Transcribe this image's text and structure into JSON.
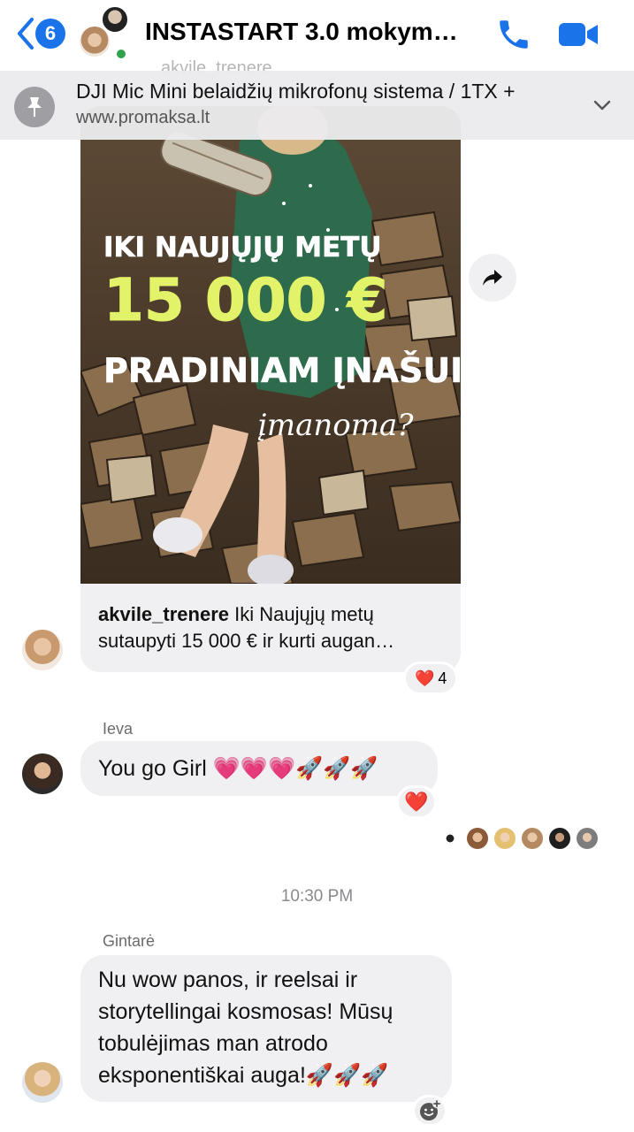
{
  "header": {
    "back_count": "6",
    "title": "INSTASTART 3.0 mokymų…"
  },
  "pinned": {
    "title": "DJI Mic Mini belaidžių mikrofonų sistema / 1TX +",
    "url": "www.promaksa.lt"
  },
  "shared_post": {
    "faded_sender": "akvile_trenere",
    "image_text": {
      "line1": "IKI NAUJŲJŲ METŲ",
      "amount": "15 000 €",
      "line3": "PRADINIAM ĮNAŠUI",
      "script": "įmanoma?"
    },
    "username": "akvile_trenere",
    "caption_line1": " Iki Naujųjų metų",
    "caption_line2": "sutaupyti 15 000 € ir kurti augan…",
    "reaction_emoji": "❤️",
    "reaction_count": "4"
  },
  "messages": [
    {
      "sender": "Ieva",
      "text": "You go Girl 💗💗💗🚀🚀🚀",
      "reaction": "❤️"
    },
    {
      "sender": "Gintarė",
      "line1": "Nu wow panos, ir reelsai ir",
      "line2": "storytellingai kosmosas! Mūsų",
      "line3": "tobulėjimas man atrodo",
      "line4": "eksponentiškai auga!🚀🚀🚀"
    }
  ],
  "timestamp": "10:30 PM",
  "colors": {
    "accent": "#1a73e8",
    "bubble": "#f0f0f2",
    "online": "#31a24c",
    "amount_yellow": "#e2f36a"
  }
}
